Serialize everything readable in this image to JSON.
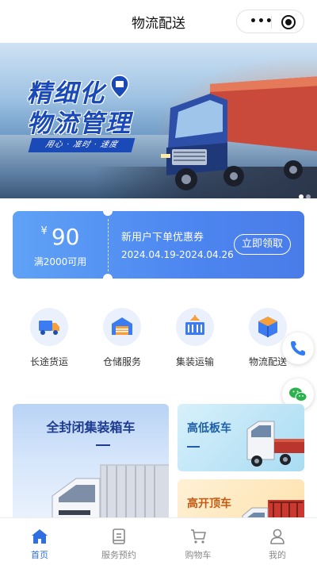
{
  "header": {
    "title": "物流配送",
    "more_icon": "more-dots-icon",
    "close_icon": "target-close-icon"
  },
  "banner": {
    "headline_line1": "精细化",
    "headline_line2": "物流管理",
    "slogan": "用心 · 准时 · 速度",
    "slide_count": 2,
    "active_slide": 1
  },
  "coupon": {
    "currency": "¥",
    "amount": "90",
    "condition": "满2000可用",
    "title": "新用户下单优惠券",
    "date_range": "2024.04.19-2024.04.26",
    "claim_label": "立即领取"
  },
  "services": [
    {
      "label": "长途货运",
      "icon": "truck-icon"
    },
    {
      "label": "仓储服务",
      "icon": "warehouse-icon"
    },
    {
      "label": "集装运输",
      "icon": "container-icon"
    },
    {
      "label": "物流配送",
      "icon": "package-icon"
    }
  ],
  "floating": {
    "phone_icon": "phone-icon",
    "wechat_icon": "wechat-icon"
  },
  "cards": {
    "big": {
      "title": "全封闭集装箱车"
    },
    "small": [
      {
        "title": "高低板车"
      },
      {
        "title": "高开顶车"
      }
    ]
  },
  "tabbar": [
    {
      "label": "首页",
      "icon": "home-icon",
      "active": true
    },
    {
      "label": "服务预约",
      "icon": "document-icon",
      "active": false
    },
    {
      "label": "购物车",
      "icon": "cart-icon",
      "active": false
    },
    {
      "label": "我的",
      "icon": "user-icon",
      "active": false
    }
  ],
  "colors": {
    "accent": "#2f6fe0",
    "coupon_start": "#5fa2f6",
    "coupon_end": "#4a7ce8",
    "icon_blue": "#3c7cf0",
    "icon_orange": "#f5a03a"
  }
}
